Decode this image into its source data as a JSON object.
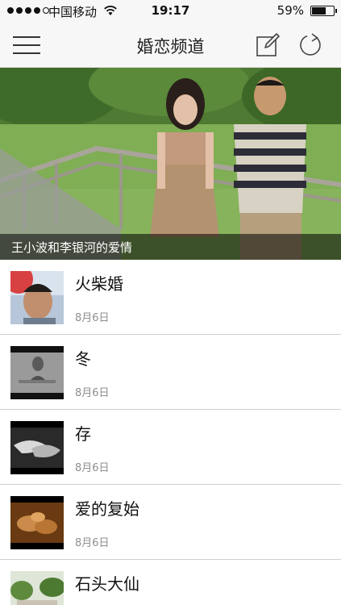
{
  "status_bar": {
    "carrier": "中国移动",
    "time": "19:17",
    "battery": "59%"
  },
  "nav": {
    "title": "婚恋频道",
    "left_icon": "menu-icon",
    "right_icons": [
      "compose-icon",
      "refresh-icon"
    ]
  },
  "hero": {
    "caption": "王小波和李银河的爱情"
  },
  "list": {
    "items": [
      {
        "title": "火柴婚",
        "date": "8月6日"
      },
      {
        "title": "冬",
        "date": "8月6日"
      },
      {
        "title": "存",
        "date": "8月6日"
      },
      {
        "title": "爱的复始",
        "date": "8月6日"
      },
      {
        "title": "石头大仙",
        "date": ""
      }
    ]
  },
  "colors": {
    "bar_background": "#f7f7f7",
    "divider": "#d0d0d0",
    "date_text": "#8e8e8e"
  }
}
